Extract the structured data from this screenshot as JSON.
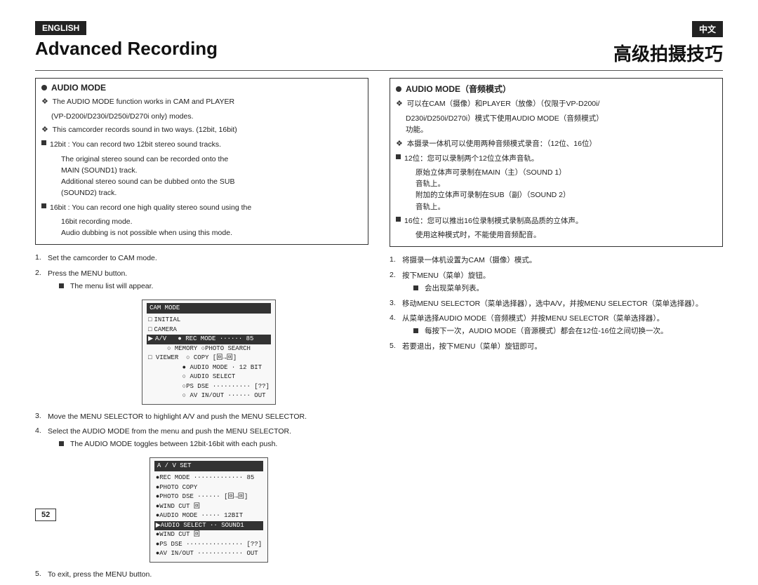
{
  "page": {
    "number": "52",
    "lang_en": "ENGLISH",
    "lang_zh": "中文",
    "title_en": "Advanced Recording",
    "title_zh": "高级拍摄技巧"
  },
  "left": {
    "section_title": "AUDIO MODE",
    "content": {
      "intro1": "The AUDIO MODE function works in CAM and PLAYER",
      "intro2": "(VP-D200i/D230i/D250i/D270i only) modes.",
      "intro3": "This camcorder records sound in two ways. (12bit, 16bit)",
      "bit12_header": "12bit : You can record two 12bit stereo sound tracks.",
      "bit12_line1": "The original stereo sound can be recorded onto the",
      "bit12_line2": "MAIN (SOUND1) track.",
      "bit12_line3": "Additional stereo sound can be dubbed onto the SUB",
      "bit12_line4": "(SOUND2) track.",
      "bit16_header": "16bit : You can record one high quality stereo sound using the",
      "bit16_line1": "16bit recording mode.",
      "bit16_line2": "Audio dubbing is not possible when using this mode."
    },
    "steps": [
      {
        "num": "1.",
        "text": "Set the camcorder to CAM mode."
      },
      {
        "num": "2.",
        "text": "Press the MENU button.",
        "sub": "The menu list will appear."
      },
      {
        "num": "3.",
        "text": "Move the MENU SELECTOR to highlight A/V and push the MENU SELECTOR."
      },
      {
        "num": "4.",
        "text": "Select the AUDIO MODE from the menu and push the MENU SELECTOR.",
        "sub": "The AUDIO MODE toggles between 12bit-16bit with each push."
      },
      {
        "num": "5.",
        "text": "To exit, press the MENU button."
      }
    ],
    "menu1": {
      "title": "CAM MODE",
      "items": [
        {
          "text": "□ INITIAL",
          "selected": false
        },
        {
          "text": "□ CAMERA",
          "selected": false
        },
        {
          "text": "□ A/V    ● REC MODE ·········  85",
          "selected": true
        },
        {
          "text": "          ○ MEMORY ○PHOTO SEARCH",
          "selected": false
        },
        {
          "text": "□ VIEWER  ○ COPY [回→回]",
          "selected": false
        },
        {
          "text": "          ● AUDIO MODE ·····  12 BIT",
          "selected": false
        },
        {
          "text": "          ○ AUDIO SELECT",
          "selected": false
        },
        {
          "text": "          ○ PS DSE ············  [??]",
          "selected": false
        },
        {
          "text": "          ○ AV IN/OUT ········  OUT",
          "selected": false
        }
      ]
    },
    "menu2": {
      "title": "A / V SET",
      "items": [
        {
          "text": "●REC MODE ·················  85",
          "selected": false
        },
        {
          "text": "●PHOTO COPY",
          "selected": false
        },
        {
          "text": "●PHOTO DSE ·········  [回→回]",
          "selected": false
        },
        {
          "text": "●WIND CUT 回",
          "selected": false
        },
        {
          "text": "●AUDIO MODE ·········  12 BIT",
          "selected": false
        },
        {
          "text": "●AUDIO SELECT ········ SOUND1",
          "selected": true
        },
        {
          "text": "●WIND CUT 回",
          "selected": false
        },
        {
          "text": "●PS DSE ·················  [??]",
          "selected": false
        },
        {
          "text": "●AV IN/OUT ···············  OUT",
          "selected": false
        }
      ]
    }
  },
  "right": {
    "section_title": "AUDIO MODE（音频模式）",
    "content": {
      "intro1": "可以在CAM（摄像）和PLAYER（放像）（仅限于VP-D200i/",
      "intro2": "D230i/D250i/D270i）模式下使用AUDIO MODE（音频模式）",
      "intro3": "功能。",
      "intro4": "本摄录一体机可以使用两种音频模式录音：（12位、16位）",
      "bit12_header": "12位：您可以录制两个12位立体声音轨。",
      "bit12_line1": "原始立体声可录制在MAIN（主）（SOUND 1）",
      "bit12_line2": "音轨上。",
      "bit12_line3": "附加的立体声可录制在SUB（副）（SOUND 2）",
      "bit12_line4": "音轨上。",
      "bit16_header": "16位：您可以推出16位录制模式录制高品质的立体声。",
      "bit16_line1": "使用这种模式时，不能使用音频配音。"
    },
    "steps": [
      {
        "num": "1.",
        "text": "将摄录一体机设置为CAM（摄像）模式。"
      },
      {
        "num": "2.",
        "text": "按下MENU（菜单）旋钮。",
        "sub": "会出现菜单列表。"
      },
      {
        "num": "3.",
        "text": "移动MENU SELECTOR（菜单选择器），选中A/V，并按MENU SELECTOR（菜单选择器）。"
      },
      {
        "num": "4.",
        "text": "从菜单选择AUDIO MODE（音频模式）并按MENU SELECTOR（菜单选择器）。",
        "sub": "每按下一次，AUDIO MODE（音源模式）都会在12位-16位之间切换一次。"
      },
      {
        "num": "5.",
        "text": "若要退出，按下MENU（菜单）旋钮即可。"
      }
    ]
  }
}
